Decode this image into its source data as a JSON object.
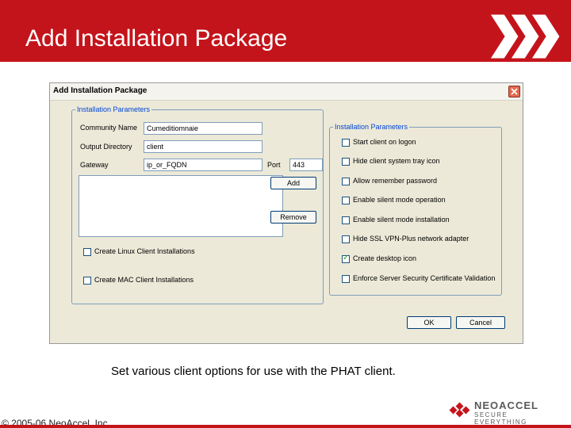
{
  "slide": {
    "title": "Add Installation Package",
    "caption": "Set various client options for use with the PHAT client.",
    "copyright": "© 2005-06 NeoAccel, Inc.",
    "logo": {
      "name": "NEOACCEL",
      "tagline": "SECURE EVERYTHING"
    },
    "accent_color": "#c4141b"
  },
  "dialog": {
    "title": "Add Installation Package",
    "left_group": {
      "legend": "Installation Parameters",
      "community_name_label": "Community Name",
      "community_name_value": "Cumeditiomnaie",
      "output_directory_label": "Output Directory",
      "output_directory_value": "client",
      "gateway_label": "Gateway",
      "gateway_value": "ip_or_FQDN",
      "port_label": "Port",
      "port_value": "443",
      "add_button": "Add",
      "remove_button": "Remove",
      "linux_checkbox_label": "Create Linux Client Installations",
      "mac_checkbox_label": "Create MAC Client Installations"
    },
    "right_group": {
      "legend": "Installation Parameters",
      "options": [
        {
          "label": "Start client on logon",
          "checked": false
        },
        {
          "label": "Hide client system tray icon",
          "checked": false
        },
        {
          "label": "Allow remember password",
          "checked": false
        },
        {
          "label": "Enable silent mode operation",
          "checked": false
        },
        {
          "label": "Enable silent mode installation",
          "checked": false
        },
        {
          "label": "Hide SSL VPN-Plus network adapter",
          "checked": false
        },
        {
          "label": "Create desktop icon",
          "checked": true
        },
        {
          "label": "Enforce Server Security Certificate Validation",
          "checked": false
        }
      ]
    },
    "ok_button": "OK",
    "cancel_button": "Cancel"
  }
}
